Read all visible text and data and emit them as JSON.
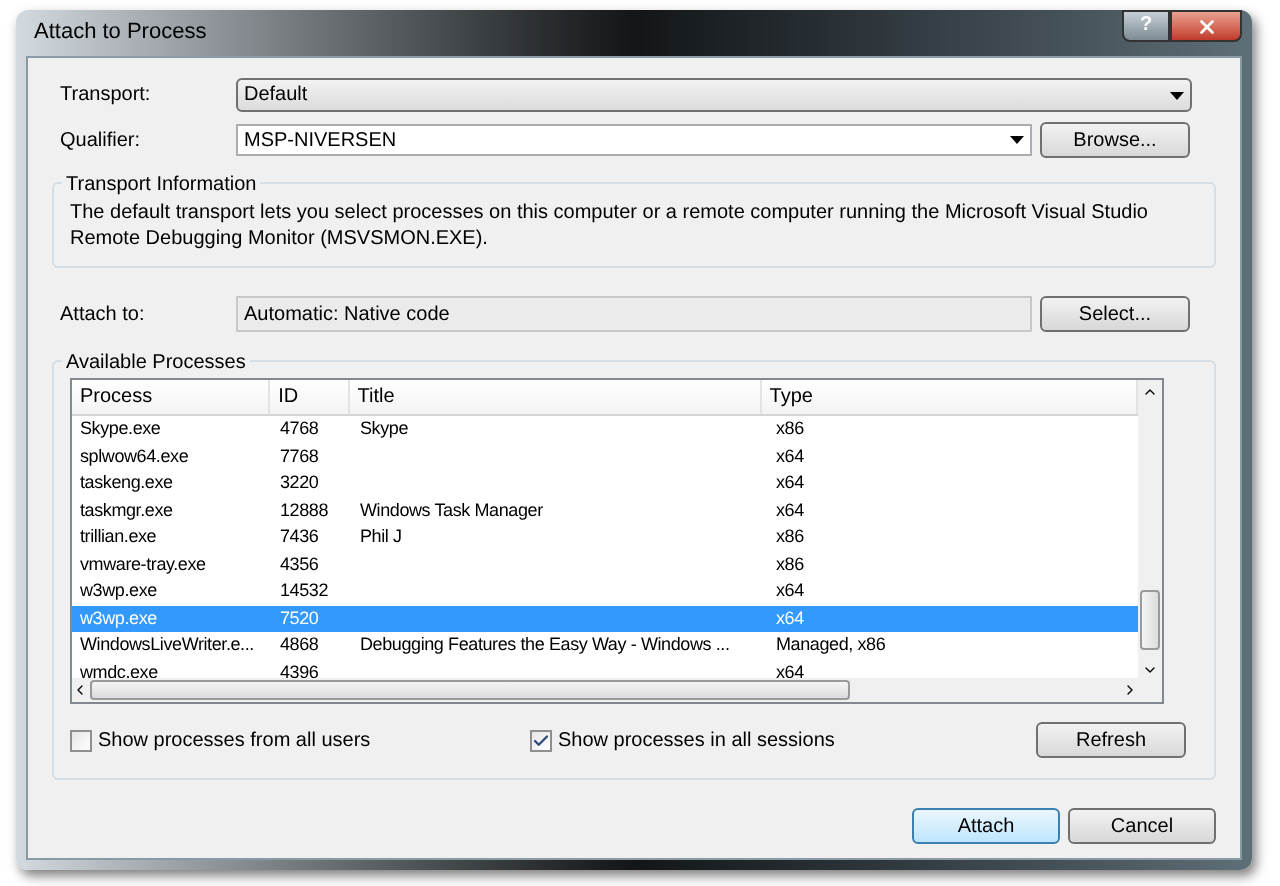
{
  "window": {
    "title": "Attach to Process",
    "help_glyph": "?"
  },
  "transport": {
    "label": "Transport:",
    "value": "Default"
  },
  "qualifier": {
    "label": "Qualifier:",
    "value": "MSP-NIVERSEN",
    "button": "Browse..."
  },
  "transport_information": {
    "title": "Transport Information",
    "text": "The default transport lets you select processes on this computer or a remote computer running the Microsoft Visual Studio Remote Debugging Monitor (MSVSMON.EXE)."
  },
  "attach_to": {
    "label": "Attach to:",
    "value": "Automatic: Native code",
    "button": "Select..."
  },
  "available_processes": {
    "title": "Available Processes",
    "table": {
      "columns": [
        "Process",
        "ID",
        "Title",
        "Type"
      ],
      "rows": [
        {
          "cells": [
            "Skype.exe",
            "4768",
            "Skype",
            "x86"
          ],
          "selected": false
        },
        {
          "cells": [
            "splwow64.exe",
            "7768",
            "",
            "x64"
          ],
          "selected": false
        },
        {
          "cells": [
            "taskeng.exe",
            "3220",
            "",
            "x64"
          ],
          "selected": false
        },
        {
          "cells": [
            "taskmgr.exe",
            "12888",
            "Windows Task Manager",
            "x64"
          ],
          "selected": false
        },
        {
          "cells": [
            "trillian.exe",
            "7436",
            "Phil J",
            "x86"
          ],
          "selected": false
        },
        {
          "cells": [
            "vmware-tray.exe",
            "4356",
            "",
            "x86"
          ],
          "selected": false
        },
        {
          "cells": [
            "w3wp.exe",
            "14532",
            "",
            "x64"
          ],
          "selected": false
        },
        {
          "cells": [
            "w3wp.exe",
            "7520",
            "",
            "x64"
          ],
          "selected": true
        },
        {
          "cells": [
            "WindowsLiveWriter.e...",
            "4868",
            "Debugging Features the Easy Way - Windows ...",
            "Managed, x86"
          ],
          "selected": false
        },
        {
          "cells": [
            "wmdc.exe",
            "4396",
            "",
            "x64"
          ],
          "selected": false
        }
      ]
    },
    "options": [
      {
        "label": "Show processes from all users",
        "checked": false
      },
      {
        "label": "Show processes in all sessions",
        "checked": true
      }
    ],
    "refresh_button": "Refresh"
  },
  "buttons": [
    {
      "label": "Attach",
      "kind": "default"
    },
    {
      "label": "Cancel",
      "kind": "normal"
    }
  ]
}
